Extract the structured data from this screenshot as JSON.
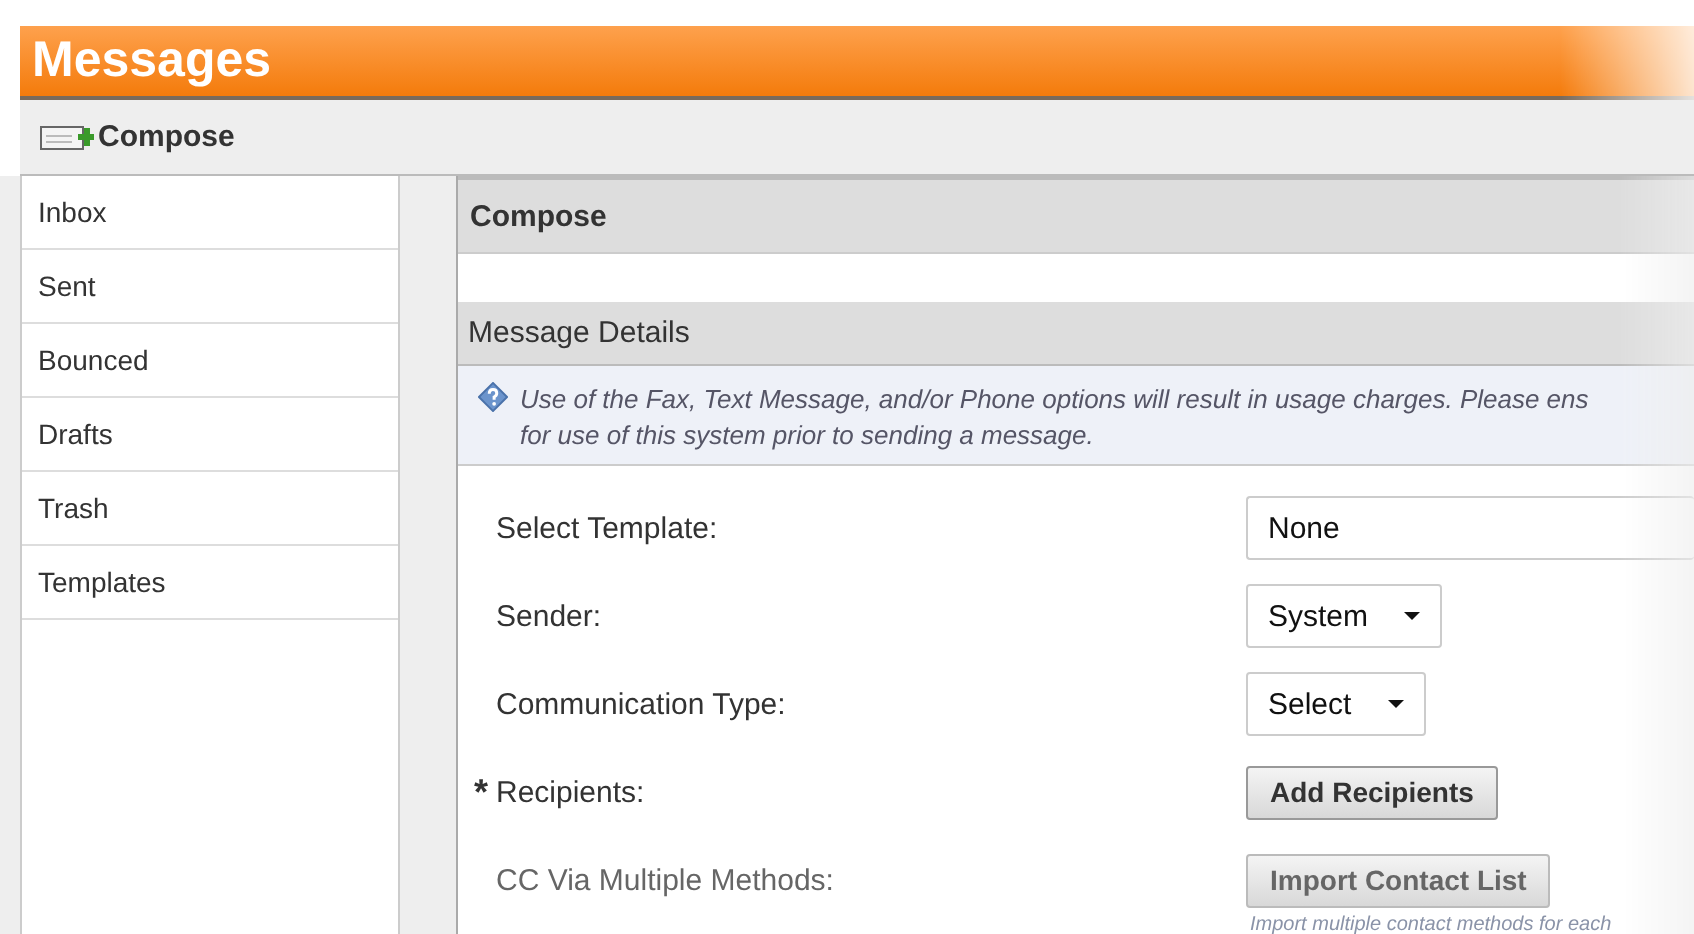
{
  "header": {
    "title": "Messages"
  },
  "toolbar": {
    "compose": "Compose"
  },
  "sidebar": {
    "items": [
      {
        "label": "Inbox"
      },
      {
        "label": "Sent"
      },
      {
        "label": "Bounced"
      },
      {
        "label": "Drafts"
      },
      {
        "label": "Trash"
      },
      {
        "label": "Templates"
      }
    ]
  },
  "panel": {
    "title": "Compose",
    "section": "Message Details",
    "notice": [
      "Use of the Fax, Text Message, and/or Phone options will result in usage charges. Please ens",
      "for use of this system prior to sending a message."
    ],
    "fields": [
      {
        "kind": "text",
        "label": "Select Template:",
        "value": "None",
        "disabled": false
      },
      {
        "kind": "select",
        "label": "Sender:",
        "value": "System",
        "disabled": false
      },
      {
        "kind": "select",
        "label": "Communication Type:",
        "value": "Select",
        "disabled": false
      },
      {
        "kind": "button",
        "label": "Recipients:",
        "marker": "*",
        "value": "Add Recipients",
        "disabled": false
      },
      {
        "kind": "button",
        "label": "CC Via Multiple Methods:",
        "value": "Import Contact List",
        "disabled": true,
        "hint": "Import multiple contact methods for each"
      }
    ]
  }
}
